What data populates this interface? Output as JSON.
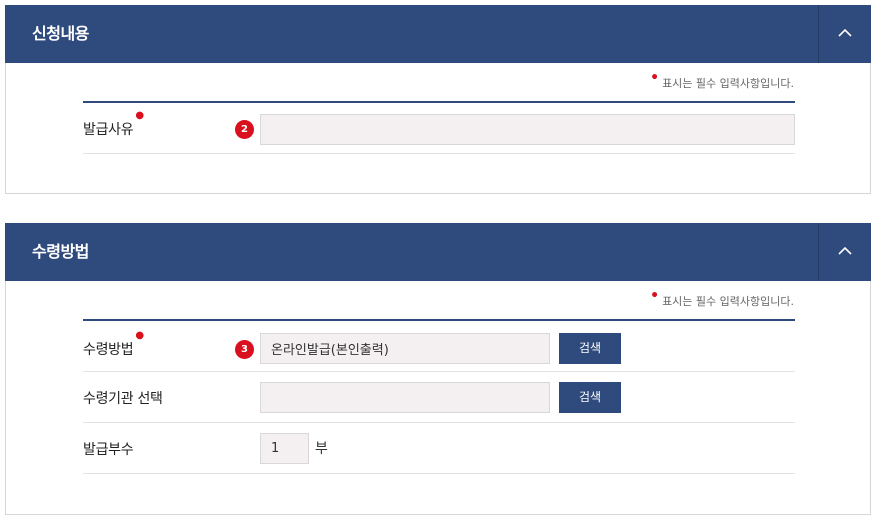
{
  "sections": [
    {
      "title": "신청내용",
      "required_note": "표시는 필수 입력사항입니다.",
      "rows": [
        {
          "label": "발급사유",
          "step": "2",
          "value": ""
        }
      ]
    },
    {
      "title": "수령방법",
      "required_note": "표시는 필수 입력사항입니다.",
      "rows": [
        {
          "label": "수령방법",
          "step": "3",
          "value": "온라인발급(본인출력)",
          "button": "검색"
        },
        {
          "label": "수령기관 선택",
          "value": "",
          "button": "검색"
        },
        {
          "label": "발급부수",
          "value": "1",
          "unit": "부"
        }
      ]
    }
  ],
  "colors": {
    "header_bg": "#2f4a7c",
    "required_dot": "#d9101e",
    "input_bg": "#f4eff0"
  },
  "icons": {
    "collapse": "chevron-up-icon",
    "required": "required-dot-icon"
  }
}
